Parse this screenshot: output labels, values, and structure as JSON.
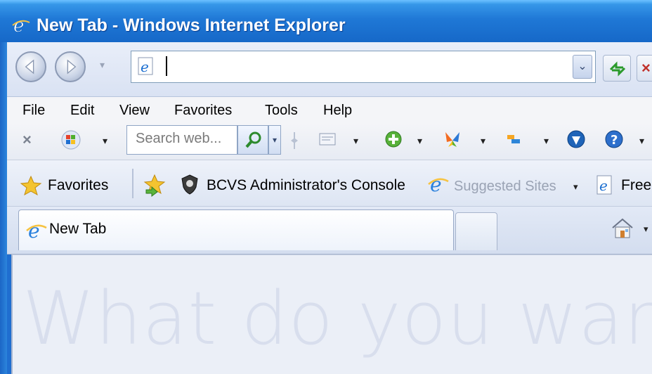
{
  "window": {
    "title": "New Tab - Windows Internet Explorer"
  },
  "address_bar": {
    "value": ""
  },
  "menu": {
    "items": [
      "File",
      "Edit",
      "View",
      "Favorites",
      "Tools",
      "Help"
    ]
  },
  "command_bar": {
    "search_placeholder": "Search web..."
  },
  "favorites_bar": {
    "favorites_label": "Favorites",
    "items": [
      {
        "label": "BCVS Administrator's Console"
      },
      {
        "label": "Suggested Sites"
      },
      {
        "label": "Free"
      }
    ]
  },
  "tabs": [
    {
      "label": "New Tab",
      "active": true
    }
  ],
  "content": {
    "headline": "What do you war"
  },
  "colors": {
    "titlebar": "#1f78d6",
    "headline": "#d8deed",
    "suggested_sites_text": "#9aa3b4"
  }
}
